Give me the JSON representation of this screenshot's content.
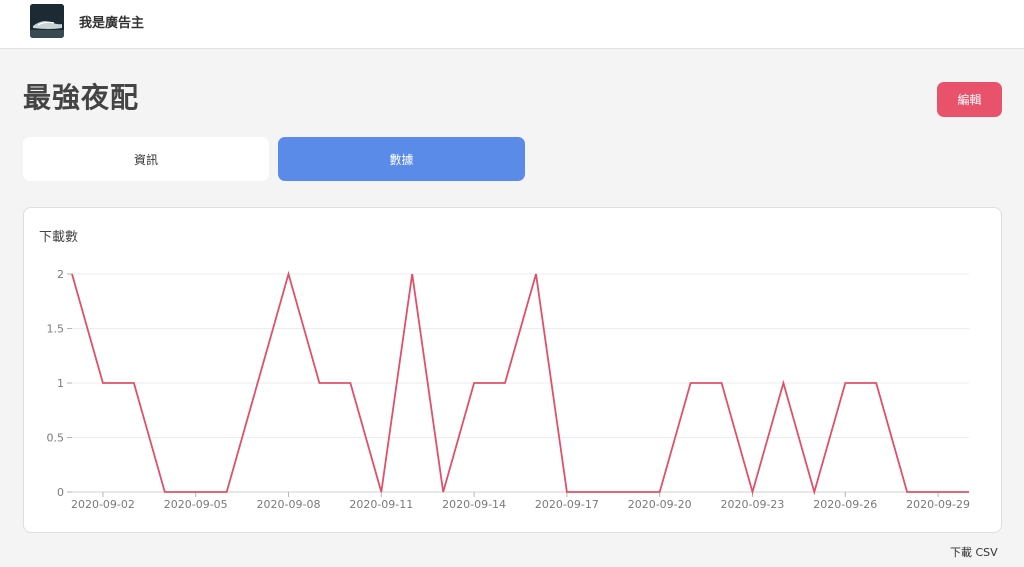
{
  "header": {
    "brand": "我是廣告主"
  },
  "page": {
    "title": "最強夜配",
    "edit_label": "編輯"
  },
  "tabs": [
    {
      "label": "資訊",
      "active": false
    },
    {
      "label": "數據",
      "active": true
    }
  ],
  "colors": {
    "accent": "#e8526a",
    "tab_active": "#5b8be9",
    "line": "#e0506a"
  },
  "chart_data": {
    "type": "line",
    "title": "下載數",
    "x": [
      "2020-09-01",
      "2020-09-02",
      "2020-09-03",
      "2020-09-04",
      "2020-09-05",
      "2020-09-06",
      "2020-09-07",
      "2020-09-08",
      "2020-09-09",
      "2020-09-10",
      "2020-09-11",
      "2020-09-12",
      "2020-09-13",
      "2020-09-14",
      "2020-09-15",
      "2020-09-16",
      "2020-09-17",
      "2020-09-18",
      "2020-09-19",
      "2020-09-20",
      "2020-09-21",
      "2020-09-22",
      "2020-09-23",
      "2020-09-24",
      "2020-09-25",
      "2020-09-26",
      "2020-09-27",
      "2020-09-28",
      "2020-09-29",
      "2020-09-30"
    ],
    "values": [
      2,
      1,
      1,
      0,
      0,
      0,
      1,
      2,
      1,
      1,
      0,
      2,
      0,
      1,
      1,
      2,
      0,
      0,
      0,
      0,
      1,
      1,
      0,
      1,
      0,
      1,
      1,
      0,
      0,
      0
    ],
    "x_ticks": [
      "2020-09-02",
      "2020-09-05",
      "2020-09-08",
      "2020-09-11",
      "2020-09-14",
      "2020-09-17",
      "2020-09-20",
      "2020-09-23",
      "2020-09-26",
      "2020-09-29"
    ],
    "y_ticks": [
      "0",
      "0.5",
      "1",
      "1.5",
      "2"
    ],
    "ylim": [
      0,
      2
    ],
    "grid": true
  },
  "footer": {
    "csv_label": "下載 CSV"
  }
}
